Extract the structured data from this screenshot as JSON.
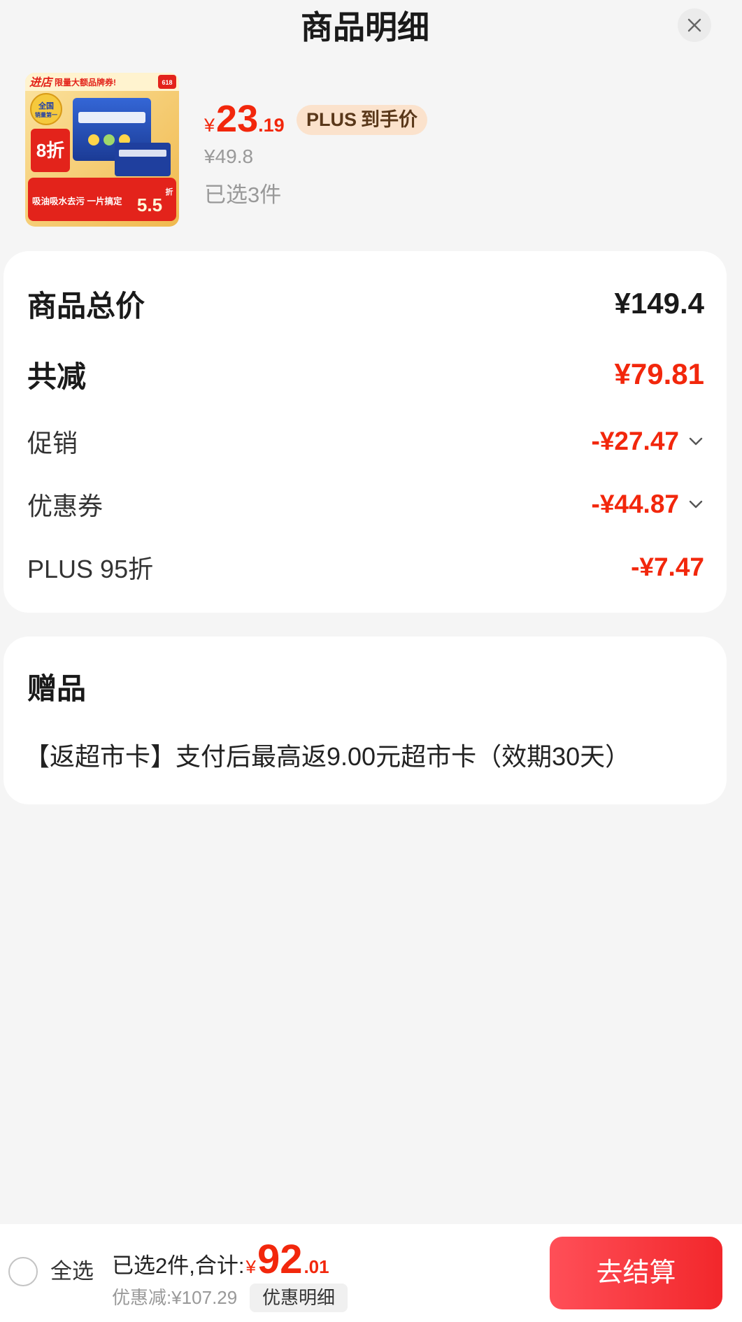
{
  "header": {
    "title": "商品明细",
    "close_icon": "close-icon"
  },
  "product": {
    "image_text": {
      "shop_tag": "进店",
      "coupon_banner": "限量大额品牌券!",
      "event_badge": "618",
      "seal_top": "全国",
      "seal_bottom": "销量第一",
      "discount_tag": "8折",
      "feature_banner": "吸油吸水去污 一片搞定",
      "bundle_value": "5.5",
      "bundle_unit": "折"
    },
    "price": {
      "currency": "¥",
      "integer": "23",
      "decimal": ".19"
    },
    "price_badge": {
      "brand": "PLUS",
      "label": "到手价"
    },
    "original_price": "¥49.8",
    "selected_count": "已选3件"
  },
  "price_detail": {
    "total": {
      "label": "商品总价",
      "value": "¥149.4"
    },
    "reduction": {
      "label": "共减",
      "value": "¥79.81"
    },
    "breakdown": [
      {
        "label": "促销",
        "value": "-¥27.47",
        "expandable": true
      },
      {
        "label": "优惠券",
        "value": "-¥44.87",
        "expandable": true
      },
      {
        "label": "PLUS 95折",
        "value": "-¥7.47",
        "expandable": false
      }
    ]
  },
  "gifts": {
    "title": "赠品",
    "items": [
      "【返超市卡】支付后最高返9.00元超市卡（效期30天）"
    ]
  },
  "footer": {
    "select_all": {
      "label": "全选",
      "checked": false
    },
    "summary_label": "已选2件,合计:",
    "total": {
      "currency": "¥",
      "integer": "92",
      "decimal": ".01"
    },
    "discount_text": "优惠减:¥107.29",
    "discount_detail_button": "优惠明细",
    "checkout_button": "去结算"
  },
  "icons": {
    "close": "close-icon",
    "expand": "chevron-down-icon",
    "select": "circle-checkbox-icon"
  },
  "colors": {
    "accent_red": "#f2270c",
    "plus_badge_bg": "#fbe2cc",
    "plus_badge_text": "#5a381a",
    "page_background": "#f5f5f5",
    "muted_text": "#999999"
  }
}
